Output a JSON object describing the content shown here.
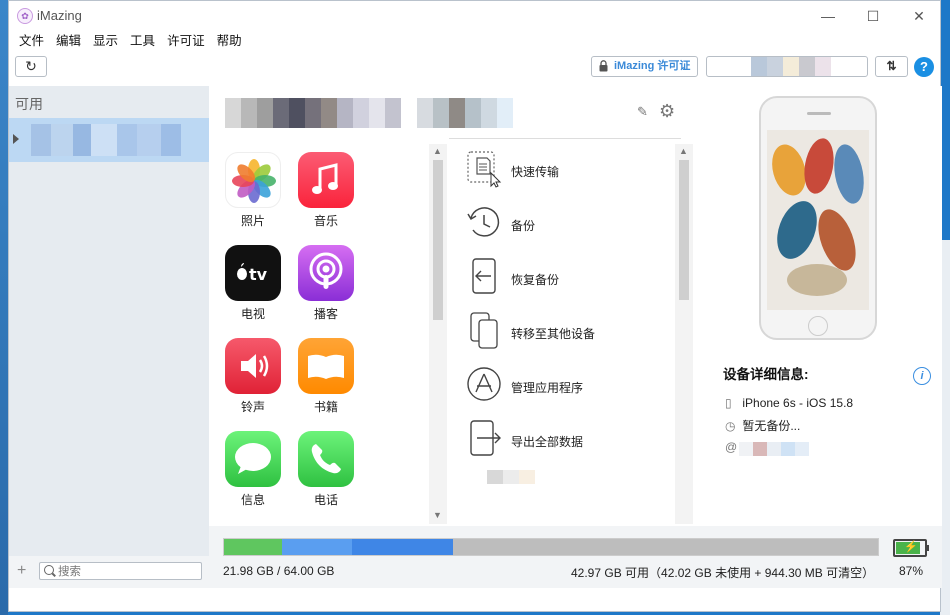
{
  "window": {
    "app_title": "iMazing",
    "minimize": "—",
    "maximize": "☐",
    "close": "✕"
  },
  "menu": [
    "文件",
    "编辑",
    "显示",
    "工具",
    "许可证",
    "帮助"
  ],
  "toolbar": {
    "refresh": "↻",
    "license": "iMazing 许可证",
    "sort": "⇅",
    "help": "?"
  },
  "sidebar": {
    "heading": "可用",
    "search_placeholder": "搜索",
    "add": "+"
  },
  "main": {
    "edit": "✎",
    "gear": "⚙"
  },
  "apps": [
    {
      "label": "照片",
      "icon": "photos-icon"
    },
    {
      "label": "音乐",
      "icon": "music-icon"
    },
    {
      "label": "电视",
      "icon": "tv-icon"
    },
    {
      "label": "播客",
      "icon": "podcasts-icon"
    },
    {
      "label": "铃声",
      "icon": "ringtones-icon"
    },
    {
      "label": "书籍",
      "icon": "books-icon"
    },
    {
      "label": "信息",
      "icon": "messages-icon"
    },
    {
      "label": "电话",
      "icon": "phone-icon"
    }
  ],
  "actions": [
    {
      "label": "快速传输",
      "icon": "quick-transfer-icon"
    },
    {
      "label": "备份",
      "icon": "backup-icon"
    },
    {
      "label": "恢复备份",
      "icon": "restore-backup-icon"
    },
    {
      "label": "转移至其他设备",
      "icon": "transfer-device-icon"
    },
    {
      "label": "管理应用程序",
      "icon": "manage-apps-icon"
    },
    {
      "label": "导出全部数据",
      "icon": "export-data-icon"
    }
  ],
  "device_details": {
    "title": "设备详细信息:",
    "model": "iPhone 6s - iOS 15.8",
    "backup_status": "暂无备份..."
  },
  "storage": {
    "used": "21.98 GB / 64.00 GB",
    "free": "42.97 GB 可用（42.02 GB 未使用 + 944.30 MB 可清空）",
    "battery_percent": "87%",
    "segments": [
      {
        "fraction": 0.088,
        "color": "#5fc65f"
      },
      {
        "fraction": 0.108,
        "color": "#5a9ef0"
      },
      {
        "fraction": 0.154,
        "color": "#3f86e6"
      },
      {
        "fraction": 0.65,
        "color": "#bdbdbd"
      }
    ],
    "battery_fraction": 0.87
  },
  "colors": {
    "accent": "#1a8fe3",
    "sidebar_selected": "#bcd8f3"
  }
}
